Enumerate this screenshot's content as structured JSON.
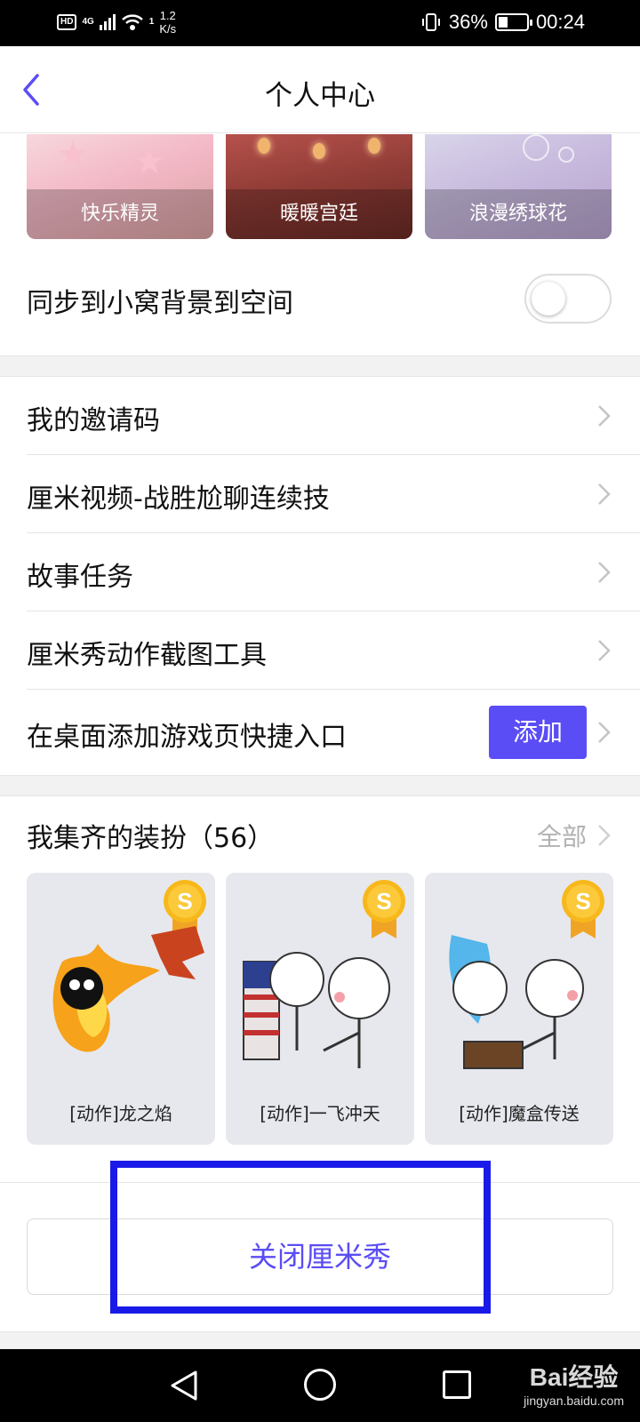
{
  "status_bar": {
    "hd": "HD",
    "network": "4G",
    "wifi_count": "1",
    "speed_top": "1.2",
    "speed_bottom": "K/s",
    "battery": "36%",
    "time": "00:24"
  },
  "header": {
    "title": "个人中心"
  },
  "themes": [
    {
      "label": "快乐精灵"
    },
    {
      "label": "暖暖宫廷"
    },
    {
      "label": "浪漫绣球花"
    }
  ],
  "sync": {
    "label": "同步到小窝背景到空间",
    "enabled": false
  },
  "list": {
    "items": [
      {
        "label": "我的邀请码"
      },
      {
        "label": "厘米视频-战胜尬聊连续技"
      },
      {
        "label": "故事任务"
      },
      {
        "label": "厘米秀动作截图工具"
      },
      {
        "label": "在桌面添加游戏页快捷入口",
        "button": "添加"
      }
    ]
  },
  "collection": {
    "title": "我集齐的装扮（56）",
    "all_label": "全部",
    "medal_letter": "S",
    "cards": [
      {
        "caption": "[动作]龙之焰"
      },
      {
        "caption": "[动作]一飞冲天"
      },
      {
        "caption": "[动作]魔盒传送"
      }
    ]
  },
  "close_button": {
    "label": "关闭厘米秀"
  },
  "watermark": {
    "main": "Bai经验",
    "sub": "jingyan.baidu.com"
  },
  "colors": {
    "accent": "#5b4df5",
    "highlight": "#1a1ae8"
  }
}
